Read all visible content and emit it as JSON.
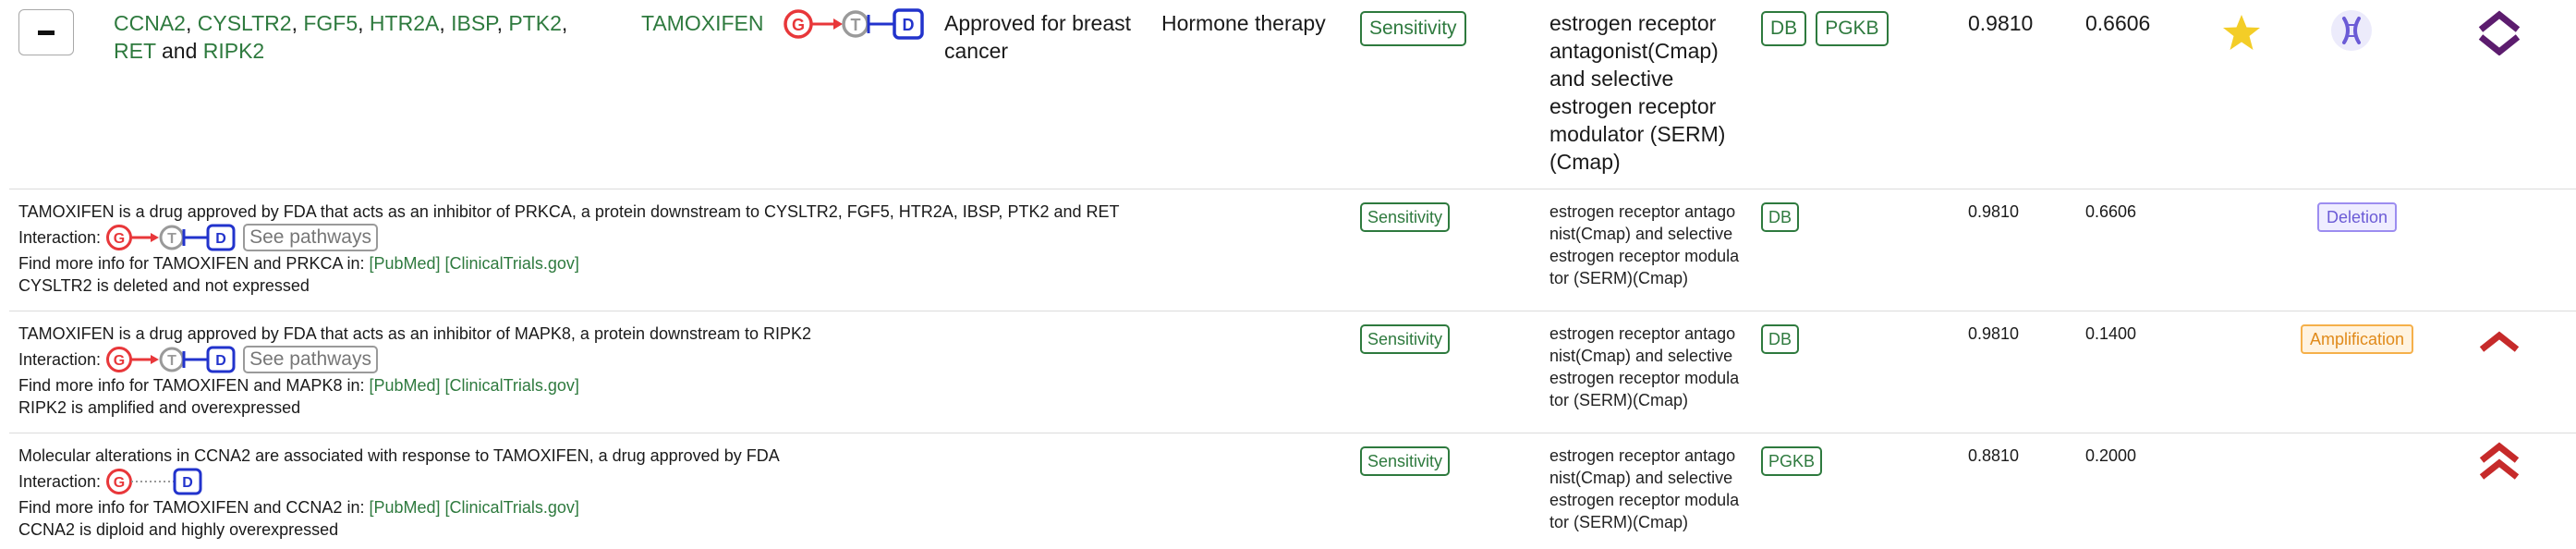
{
  "main_row": {
    "genes": [
      {
        "name": "CCNA2",
        "sep": ", "
      },
      {
        "name": "CYSLTR2",
        "sep": ", "
      },
      {
        "name": "FGF5",
        "sep": ", "
      },
      {
        "name": "HTR2A",
        "sep": ", "
      },
      {
        "name": "IBSP",
        "sep": ", "
      },
      {
        "name": "PTK2",
        "sep": ", "
      },
      {
        "name": "RET",
        "sep": " and "
      },
      {
        "name": "RIPK2",
        "sep": ""
      }
    ],
    "drug": "TAMOXIFEN",
    "status": "Approved for breast cancer",
    "therapy": "Hormone therapy",
    "response": "Sensitivity",
    "moa": "estrogen receptor antagonist(Cmap) and selective estrogen receptor modulator (SERM)(Cmap)",
    "sources": [
      "DB",
      "PGKB"
    ],
    "score1": "0.9810",
    "score2": "0.6606"
  },
  "interaction_glyphs": {
    "g": "G",
    "t": "T",
    "d": "D"
  },
  "sub_rows": [
    {
      "desc": "TAMOXIFEN is a drug approved by FDA that acts as an inhibitor of PRKCA, a protein downstream to CYSLTR2, FGF5, HTR2A, IBSP, PTK2 and RET",
      "interaction_label": "Interaction:",
      "see_pathways": "See pathways",
      "find_more": "Find more info for TAMOXIFEN and PRKCA in:",
      "pubmed": "[PubMed]",
      "clinicaltrials": "[ClinicalTrials.gov]",
      "alteration": "CYSLTR2 is deleted and not expressed",
      "response": "Sensitivity",
      "moa": "estrogen receptor antagonist(Cmap) and selective estrogen receptor modulator (SERM)(Cmap)",
      "sources": [
        "DB"
      ],
      "score1": "0.9810",
      "score2": "0.6606",
      "cnv": "Deletion"
    },
    {
      "desc": "TAMOXIFEN is a drug approved by FDA that acts as an inhibitor of MAPK8, a protein downstream to RIPK2",
      "interaction_label": "Interaction:",
      "see_pathways": "See pathways",
      "find_more": "Find more info for TAMOXIFEN and MAPK8 in:",
      "pubmed": "[PubMed]",
      "clinicaltrials": "[ClinicalTrials.gov]",
      "alteration": "RIPK2 is amplified and overexpressed",
      "response": "Sensitivity",
      "moa": "estrogen receptor antagonist(Cmap) and selective estrogen receptor modulator (SERM)(Cmap)",
      "sources": [
        "DB"
      ],
      "score1": "0.9810",
      "score2": "0.1400",
      "cnv": "Amplification"
    },
    {
      "desc": "Molecular alterations in CCNA2 are associated with response to TAMOXIFEN, a drug approved by FDA",
      "interaction_label": "Interaction:",
      "find_more": "Find more info for TAMOXIFEN and CCNA2 in:",
      "pubmed": "[PubMed]",
      "clinicaltrials": "[ClinicalTrials.gov]",
      "alteration": "CCNA2 is diploid and highly overexpressed",
      "response": "Sensitivity",
      "moa": "estrogen receptor antagonist(Cmap) and selective estrogen receptor modulator (SERM)(Cmap)",
      "sources": [
        "PGKB"
      ],
      "score1": "0.8810",
      "score2": "0.2000"
    }
  ],
  "icons": {
    "star": "star-icon",
    "chromosome": "chromosome-icon",
    "expression_up": "chevron-up-icon",
    "expression_double_up": "double-chevron-up-icon"
  },
  "colors": {
    "accent_green": "#2e7a3e",
    "g_red": "#e8373a",
    "t_gray": "#9a9a9a",
    "d_blue": "#2233cc",
    "star_gold": "#f3cd27",
    "chevron_purple": "#5c1c6e",
    "chevron_red": "#c62a2a"
  }
}
